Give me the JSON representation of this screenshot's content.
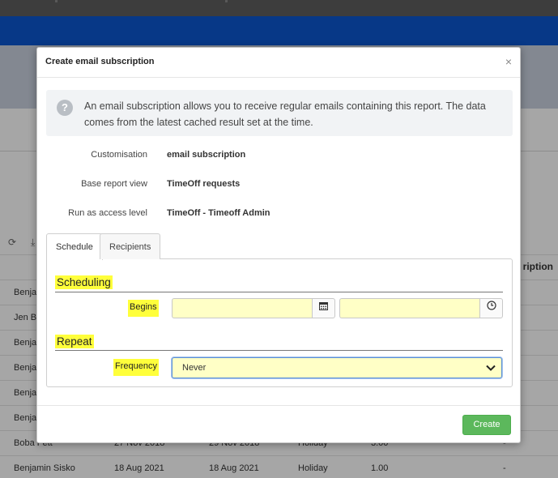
{
  "background": {
    "column_header": "ription",
    "rows": [
      {
        "name": "Benjan",
        "start": "",
        "end": "",
        "type": "",
        "days": "",
        "status": ""
      },
      {
        "name": "Jen Ba",
        "start": "",
        "end": "",
        "type": "",
        "days": "",
        "status": ""
      },
      {
        "name": "Benjan",
        "start": "",
        "end": "",
        "type": "",
        "days": "",
        "status": ""
      },
      {
        "name": "Benjan",
        "start": "",
        "end": "",
        "type": "",
        "days": "",
        "status": ""
      },
      {
        "name": "Benjan",
        "start": "",
        "end": "",
        "type": "",
        "days": "",
        "status": ""
      },
      {
        "name": "Benjan",
        "start": "",
        "end": "",
        "type": "",
        "days": "",
        "status": ""
      },
      {
        "name": "Boba Fett",
        "start": "27 Nov 2018",
        "end": "29 Nov 2018",
        "type": "Holiday",
        "days": "3.00",
        "status": "-"
      },
      {
        "name": "Benjamin Sisko",
        "start": "18 Aug 2021",
        "end": "18 Aug 2021",
        "type": "Holiday",
        "days": "1.00",
        "status": "-"
      }
    ]
  },
  "modal": {
    "title": "Create email subscription",
    "close_symbol": "×",
    "info_text": "An email subscription allows you to receive regular emails containing this report. The data comes from the latest cached result set at the time.",
    "help_symbol": "?",
    "meta": [
      {
        "label": "Customisation",
        "value": "email subscription"
      },
      {
        "label": "Base report view",
        "value": "TimeOff requests"
      },
      {
        "label": "Run as access level",
        "value": "TimeOff - Timeoff Admin"
      }
    ],
    "tabs": [
      {
        "label": "Schedule",
        "active": true
      },
      {
        "label": "Recipients",
        "active": false
      }
    ],
    "schedule": {
      "scheduling_title": "Scheduling",
      "begins_label": "Begins",
      "begins_date_value": "",
      "begins_time_value": "",
      "repeat_title": "Repeat",
      "frequency_label": "Frequency",
      "frequency_value": "Never"
    },
    "create_label": "Create"
  },
  "icons": {
    "calendar": "calendar-icon",
    "clock": "clock-icon",
    "chevron": "chevron-down-icon",
    "refresh": "refresh-icon",
    "download": "download-icon"
  },
  "colors": {
    "brand_blue": "#0b57d0",
    "highlight_yellow": "#ffff3b",
    "input_yellow": "#ffffc6",
    "create_green": "#5cb85c"
  }
}
